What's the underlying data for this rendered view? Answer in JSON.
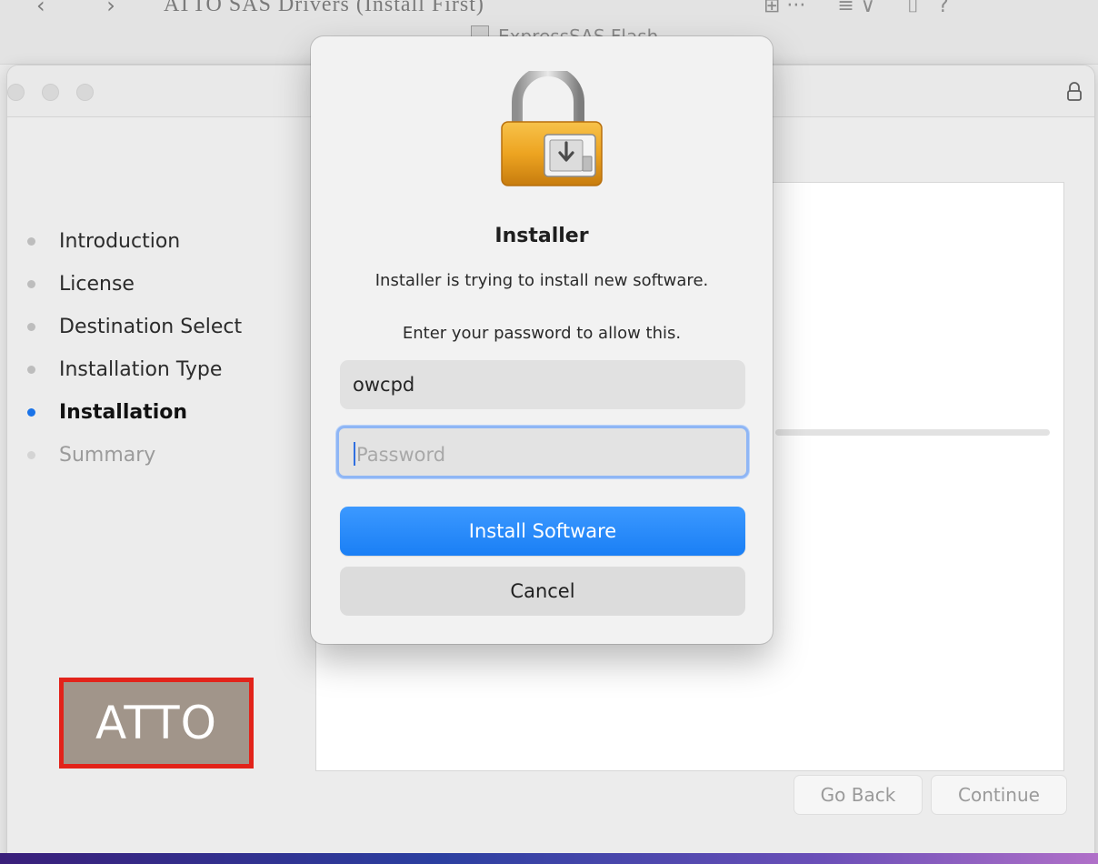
{
  "background_window": {
    "title": "ATTO SAS Drivers (Install First)",
    "subtitle": "ExpressSAS Flash"
  },
  "installer": {
    "steps": [
      {
        "label": "Introduction",
        "state": "completed"
      },
      {
        "label": "License",
        "state": "completed"
      },
      {
        "label": "Destination Select",
        "state": "completed"
      },
      {
        "label": "Installation Type",
        "state": "completed"
      },
      {
        "label": "Installation",
        "state": "active"
      },
      {
        "label": "Summary",
        "state": "pending"
      }
    ],
    "logo_text": "ATTO",
    "go_back_label": "Go Back",
    "continue_label": "Continue"
  },
  "auth_dialog": {
    "title": "Installer",
    "message": "Installer is trying to install new software.",
    "prompt": "Enter your password to allow this.",
    "username_value": "owcpd",
    "password_placeholder": "Password",
    "primary_button": "Install Software",
    "cancel_button": "Cancel"
  },
  "colors": {
    "accent_blue": "#1a7ff5",
    "active_step_dot": "#1a73e8",
    "logo_border": "#e2231a",
    "logo_fill": "#a1958a"
  },
  "icons": [
    "lock-icon",
    "installer-lock-icon"
  ]
}
